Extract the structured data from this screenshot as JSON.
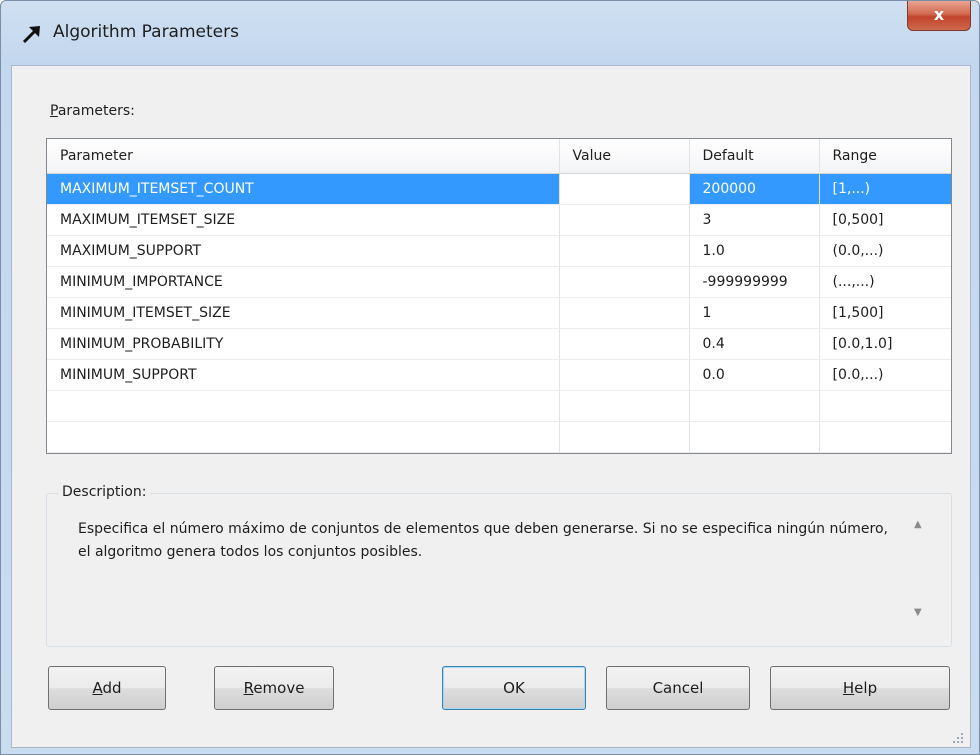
{
  "window": {
    "title": "Algorithm Parameters",
    "close_glyph": "x"
  },
  "parameters": {
    "label_accel": "P",
    "label_rest": "arameters:",
    "columns": [
      "Parameter",
      "Value",
      "Default",
      "Range"
    ],
    "rows": [
      {
        "parameter": "MAXIMUM_ITEMSET_COUNT",
        "value": "",
        "default": "200000",
        "range": "[1,...)"
      },
      {
        "parameter": "MAXIMUM_ITEMSET_SIZE",
        "value": "",
        "default": "3",
        "range": "[0,500]"
      },
      {
        "parameter": "MAXIMUM_SUPPORT",
        "value": "",
        "default": "1.0",
        "range": "(0.0,...)"
      },
      {
        "parameter": "MINIMUM_IMPORTANCE",
        "value": "",
        "default": "-999999999",
        "range": "(...,...)"
      },
      {
        "parameter": "MINIMUM_ITEMSET_SIZE",
        "value": "",
        "default": "1",
        "range": "[1,500]"
      },
      {
        "parameter": "MINIMUM_PROBABILITY",
        "value": "",
        "default": "0.4",
        "range": "[0.0,1.0]"
      },
      {
        "parameter": "MINIMUM_SUPPORT",
        "value": "",
        "default": "0.0",
        "range": "[0.0,...)"
      }
    ]
  },
  "description": {
    "label": "Description:",
    "text": "Especifica el número máximo de conjuntos de elementos que deben generarse. Si no se especifica ningún número, el algoritmo genera todos los conjuntos posibles."
  },
  "buttons": {
    "add_accel": "A",
    "add_rest": "dd",
    "remove_accel": "R",
    "remove_rest": "emove",
    "ok": "OK",
    "cancel": "Cancel",
    "help_accel": "H",
    "help_rest": "elp"
  },
  "colors": {
    "selection": "#3399ff",
    "close_button": "#c0432a",
    "window_frame": "#c3d7ee"
  },
  "icons": {
    "app": "arrow-up-right-icon",
    "scroll_up": "scroll-up-arrow-icon",
    "scroll_down": "scroll-down-arrow-icon",
    "grip": "resize-grip-icon"
  }
}
